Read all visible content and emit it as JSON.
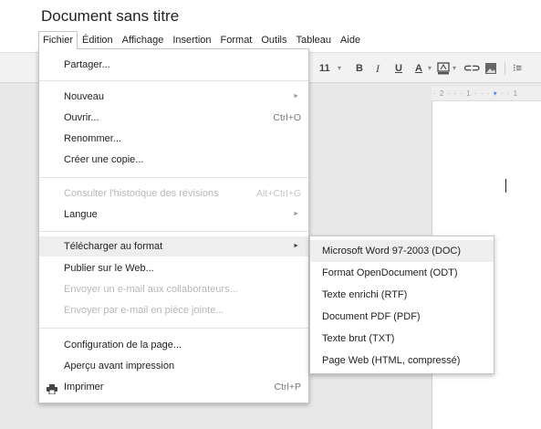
{
  "document": {
    "title": "Document sans titre"
  },
  "menubar": [
    "Fichier",
    "Édition",
    "Affichage",
    "Insertion",
    "Format",
    "Outils",
    "Tableau",
    "Aide"
  ],
  "toolbar": {
    "font_size": "11",
    "font_size_dropdown": "▾",
    "bold": "B",
    "italic": "I",
    "underline": "U",
    "text_color": "A",
    "text_color_dropdown": "▾",
    "highlight_dropdown": "▾",
    "link": "⊂⊃",
    "list": "⁝≡"
  },
  "ruler": {
    "left": "· 2 · · · 1 · · ·",
    "marker": "▾",
    "right": "· · 1"
  },
  "fichier_menu": {
    "share": "Partager...",
    "new": "Nouveau",
    "open": "Ouvrir...",
    "open_shortcut": "Ctrl+O",
    "rename": "Renommer...",
    "copy": "Créer une copie...",
    "history": "Consulter l'historique des révisions",
    "history_shortcut": "Alt+Ctrl+G",
    "language": "Langue",
    "download": "Télécharger au format",
    "publish": "Publier sur le Web...",
    "email_collab": "Envoyer un e-mail aux collaborateurs...",
    "email_attach": "Envoyer par e-mail en pièce jointe...",
    "page_setup": "Configuration de la page...",
    "preview": "Aperçu avant impression",
    "print": "Imprimer",
    "print_shortcut": "Ctrl+P",
    "arrow": "►"
  },
  "download_submenu": [
    "Microsoft Word 97-2003 (DOC)",
    "Format OpenDocument (ODT)",
    "Texte enrichi (RTF)",
    "Document PDF (PDF)",
    "Texte brut (TXT)",
    "Page Web (HTML, compressé)"
  ],
  "colors": {
    "accent": "#4d90fe",
    "menu_highlight": "#eeeeee",
    "disabled_text": "#b8b8b8"
  },
  "icons": [
    "printer-icon",
    "link-icon",
    "image-icon",
    "text-color-icon",
    "highlight-color-icon",
    "numbered-list-icon"
  ]
}
